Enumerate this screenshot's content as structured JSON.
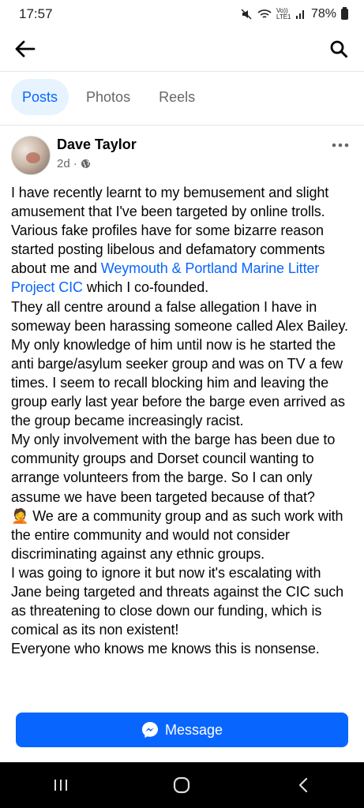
{
  "status_bar": {
    "time": "17:57",
    "network": "Vo)) LTE1",
    "battery": "78%"
  },
  "tabs": [
    {
      "label": "Posts",
      "active": true
    },
    {
      "label": "Photos",
      "active": false
    },
    {
      "label": "Reels",
      "active": false
    }
  ],
  "post": {
    "author": "Dave Taylor",
    "time": "2d",
    "separator": "·",
    "privacy_icon": "globe-icon",
    "paragraphs": {
      "p1": "I have recently learnt to my bemusement and slight amusement that I've been targeted by online trolls.",
      "p2_before": "Various fake profiles have for some bizarre reason started posting libelous and defamatory comments about me and ",
      "p2_link": "Weymouth & Portland Marine Litter Project CIC",
      "p2_after": " which I co-founded.",
      "p3": "They all centre around a false allegation I have in someway been harassing someone called Alex Bailey. My only knowledge of him until now is he started the anti barge/asylum seeker group and was on TV a few times. I seem to recall blocking him and leaving the group early last year before the barge even arrived as the group became increasingly racist.",
      "p4": "My only involvement with the barge has been due to community groups and Dorset council wanting to arrange volunteers from the barge. So I can only assume we have been targeted because of that?",
      "p5_emoji": "🤦",
      "p5": " We are a community group and as such work with the entire community and would not consider discriminating against any ethnic groups.",
      "p6": "I was going to ignore it but now it's escalating with Jane being targeted and threats against the CIC such as threatening to close down our funding, which is comical as its non existent!",
      "p7": "Everyone who knows me knows this is nonsense."
    }
  },
  "message_button": {
    "label": "Message",
    "icon": "messenger-icon"
  },
  "colors": {
    "accent": "#0866ff",
    "tab_active_bg": "#e7f3ff",
    "secondary_text": "#65676b",
    "nav_bar": "#000000"
  }
}
